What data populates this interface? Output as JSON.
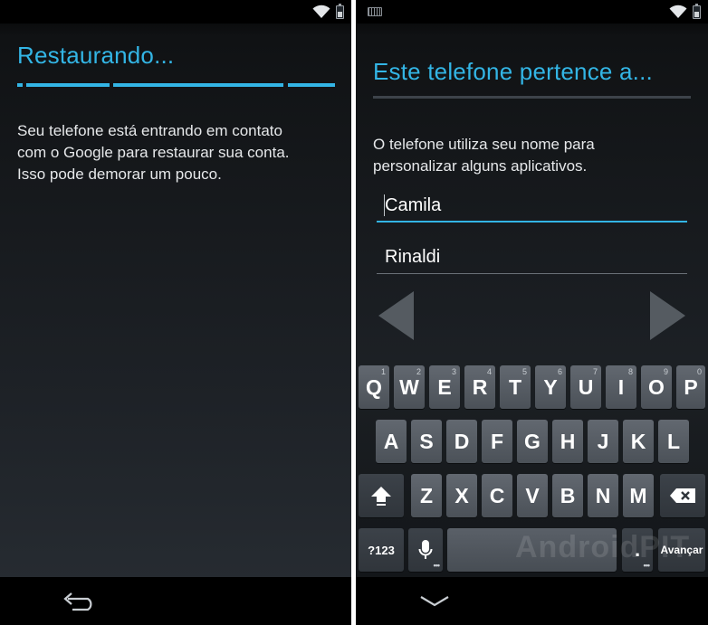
{
  "left_screen": {
    "title": "Restaurando...",
    "message": "Seu telefone está entrando em contato\ncom o Google para restaurar sua conta.\nIsso pode demorar um pouco.",
    "icons": [
      "wifi-icon",
      "battery-icon",
      "back-icon"
    ]
  },
  "right_screen": {
    "title": "Este telefone pertence a...",
    "message": "O telefone utiliza seu nome para\npersonalizar alguns aplicativos.",
    "first_name": "Camila",
    "last_name": "Rinaldi",
    "icons": [
      "keyboard-indicator-icon",
      "wifi-icon",
      "battery-icon",
      "previous-arrow-icon",
      "next-arrow-icon",
      "hide-keyboard-icon"
    ]
  },
  "keyboard": {
    "row1": [
      "Q",
      "W",
      "E",
      "R",
      "T",
      "Y",
      "U",
      "I",
      "O",
      "P"
    ],
    "row1_hints": [
      "1",
      "2",
      "3",
      "4",
      "5",
      "6",
      "7",
      "8",
      "9",
      "0"
    ],
    "row2": [
      "A",
      "S",
      "D",
      "F",
      "G",
      "H",
      "J",
      "K",
      "L"
    ],
    "row3": [
      "Z",
      "X",
      "C",
      "V",
      "B",
      "N",
      "M"
    ],
    "symbols_label": "?123",
    "period_label": ".",
    "action_label": "Avançar",
    "icons": [
      "shift-icon",
      "backspace-icon",
      "microphone-icon"
    ]
  },
  "watermark": "AndroidPIT",
  "colors": {
    "accent": "#33b5e5",
    "background": "#1d2126",
    "key": "#555b61"
  }
}
